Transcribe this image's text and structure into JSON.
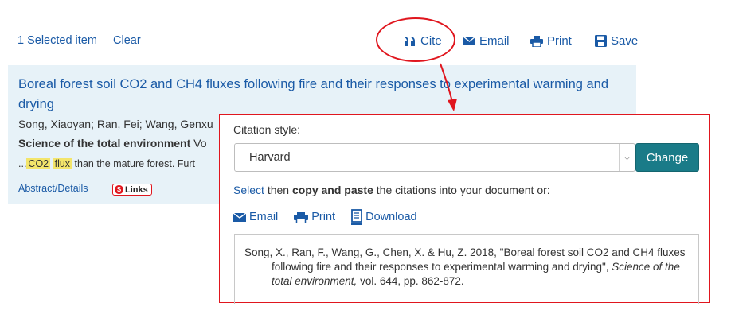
{
  "toolbar": {
    "selected_label": "1 Selected item",
    "clear_label": "Clear",
    "cite_label": "Cite",
    "email_label": "Email",
    "print_label": "Print",
    "save_label": "Save"
  },
  "result": {
    "title": "Boreal forest soil CO2 and CH4 fluxes following fire and their responses to experimental warming and drying",
    "authors": "Song, Xiaoyan; Ran, Fei; Wang, Genxu",
    "journal": "Science of the total environment",
    "journal_suffix": "Vo",
    "snippet_prefix": "...",
    "snippet_hl_1": "CO2",
    "snippet_hl_2": "flux",
    "snippet_rest": "than the mature forest. Furt",
    "abstract_label": "Abstract/Details",
    "links_label": "Links"
  },
  "citation_popup": {
    "style_label": "Citation style:",
    "style_selected": "Harvard",
    "change_label": "Change",
    "instr_select": "Select",
    "instr_then": "then",
    "instr_bold": "copy and paste",
    "instr_rest": "the citations into your document or:",
    "email_label": "Email",
    "print_label": "Print",
    "download_label": "Download",
    "citation_part1": "Song, X., Ran, F., Wang, G., Chen, X. & Hu, Z. 2018, \"Boreal forest soil CO2 and CH4 fluxes following fire and their responses to experimental warming and drying\", ",
    "citation_journal": "Science of the total environment,",
    "citation_part2": " vol. 644, pp. 862-872."
  },
  "colors": {
    "link": "#1a5aa6",
    "annotation_red": "#e0161e",
    "change_button": "#1a7b88",
    "result_bg": "#e7f2f8",
    "highlight": "#f3e56b"
  }
}
